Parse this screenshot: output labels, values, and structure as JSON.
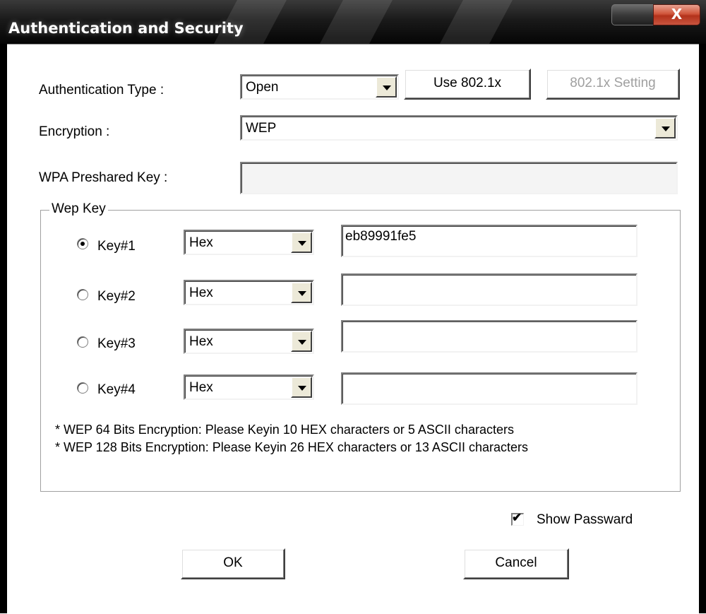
{
  "window": {
    "title": "Authentication and Security",
    "close_glyph": "X"
  },
  "auth": {
    "label": "Authentication Type :",
    "value": "Open",
    "use_8021x_label": "Use 802.1x",
    "setting_8021x_label": "802.1x Setting"
  },
  "encryption": {
    "label": "Encryption :",
    "value": "WEP"
  },
  "wpa": {
    "label": "WPA Preshared Key :",
    "value": ""
  },
  "wep": {
    "group_title": "Wep Key",
    "keys": [
      {
        "label": "Key#1",
        "format": "Hex",
        "value": "eb89991fe5",
        "selected": true
      },
      {
        "label": "Key#2",
        "format": "Hex",
        "value": "",
        "selected": false
      },
      {
        "label": "Key#3",
        "format": "Hex",
        "value": "",
        "selected": false
      },
      {
        "label": "Key#4",
        "format": "Hex",
        "value": "",
        "selected": false
      }
    ],
    "note_64": "* WEP 64 Bits Encryption:  Please Keyin 10 HEX characters or 5 ASCII characters",
    "note_128": "* WEP 128 Bits Encryption:  Please Keyin 26 HEX characters or 13 ASCII characters"
  },
  "show_password": {
    "label": "Show Passward",
    "checked": true
  },
  "buttons": {
    "ok": "OK",
    "cancel": "Cancel"
  }
}
